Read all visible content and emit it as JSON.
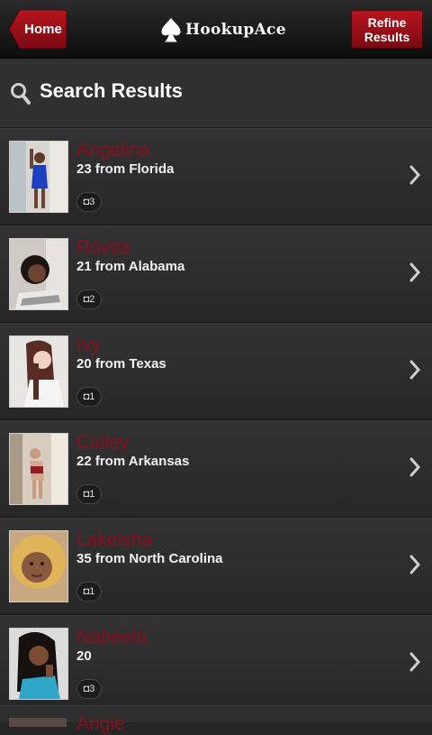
{
  "header": {
    "home_label": "Home",
    "logo_text": "HookupAce",
    "refine_label_line1": "Refine",
    "refine_label_line2": "Results"
  },
  "search": {
    "title": "Search Results"
  },
  "results": [
    {
      "name": "Angelina",
      "detail": "23 from Florida",
      "photos": "3"
    },
    {
      "name": "Rovita",
      "detail": "21 from Alabama",
      "photos": "2"
    },
    {
      "name": "Ivy",
      "detail": "20 from Texas",
      "photos": "1"
    },
    {
      "name": "Cailey",
      "detail": "22 from Arkansas",
      "photos": "1"
    },
    {
      "name": "Lakeisha",
      "detail": "35 from North Carolina",
      "photos": "1"
    },
    {
      "name": "Nabeela",
      "detail": "20",
      "photos": "3"
    }
  ],
  "partial_row": {
    "name": "Angie"
  },
  "colors": {
    "accent_red": "#8a0f1c",
    "button_red": "#b8141f",
    "background": "#262626"
  },
  "icons": {
    "search": "search-icon",
    "chevron": "chevron-right-icon",
    "camera": "camera-icon",
    "spade": "spade-icon"
  }
}
